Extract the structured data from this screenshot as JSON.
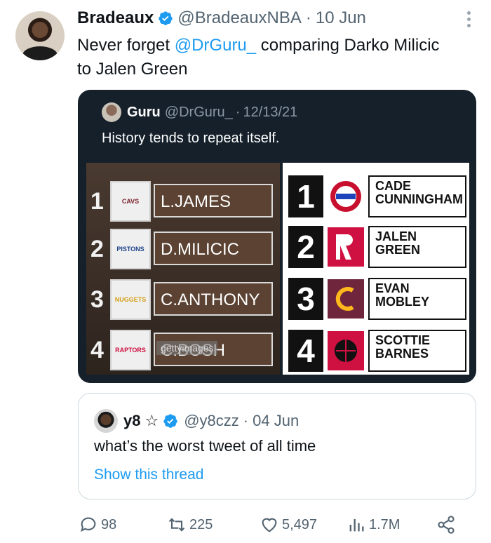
{
  "tweet": {
    "name": "Bradeaux",
    "handle": "@BradeauxNBA",
    "separator": "·",
    "date": "10 Jun",
    "text_prefix": "Never forget ",
    "mention": "@DrGuru_",
    "text_suffix": " comparing Darko Milicic to Jalen Green"
  },
  "embedded": {
    "name": "Guru",
    "handle": "@DrGuru_",
    "separator": "·",
    "date": "12/13/21",
    "text": "History tends to repeat itself.",
    "watermark": "gettyimages",
    "left_board": [
      {
        "num": "1",
        "logo": "CAVS",
        "player": "L.JAMES"
      },
      {
        "num": "2",
        "logo": "PISTONS",
        "player": "D.MILICIC"
      },
      {
        "num": "3",
        "logo": "NUGGETS",
        "player": "C.ANTHONY"
      },
      {
        "num": "4",
        "logo": "RAPTORS",
        "player": "C.BOSH"
      }
    ],
    "right_board": [
      {
        "num": "1",
        "logo_color": "#c8102e",
        "player_line1": "CADE",
        "player_line2": "CUNNINGHAM"
      },
      {
        "num": "2",
        "logo_color": "#ce1141",
        "player_line1": "JALEN",
        "player_line2": "GREEN"
      },
      {
        "num": "3",
        "logo_color": "#6f263d",
        "player_line1": "EVAN",
        "player_line2": "MOBLEY"
      },
      {
        "num": "4",
        "logo_color": "#ce1141",
        "player_line1": "SCOTTIE",
        "player_line2": "BARNES"
      }
    ]
  },
  "quoted": {
    "name": "y8",
    "star": "☆",
    "handle": "@y8czz",
    "separator": "·",
    "date": "04 Jun",
    "text": "what’s the worst tweet of all time",
    "link": "Show this thread"
  },
  "actions": {
    "replies": "98",
    "retweets": "225",
    "likes": "5,497",
    "views": "1.7M"
  },
  "colors": {
    "accent": "#1d9bf0",
    "muted": "#536471",
    "verified": "#1d9bf0",
    "retweet_icon": "#536471"
  }
}
